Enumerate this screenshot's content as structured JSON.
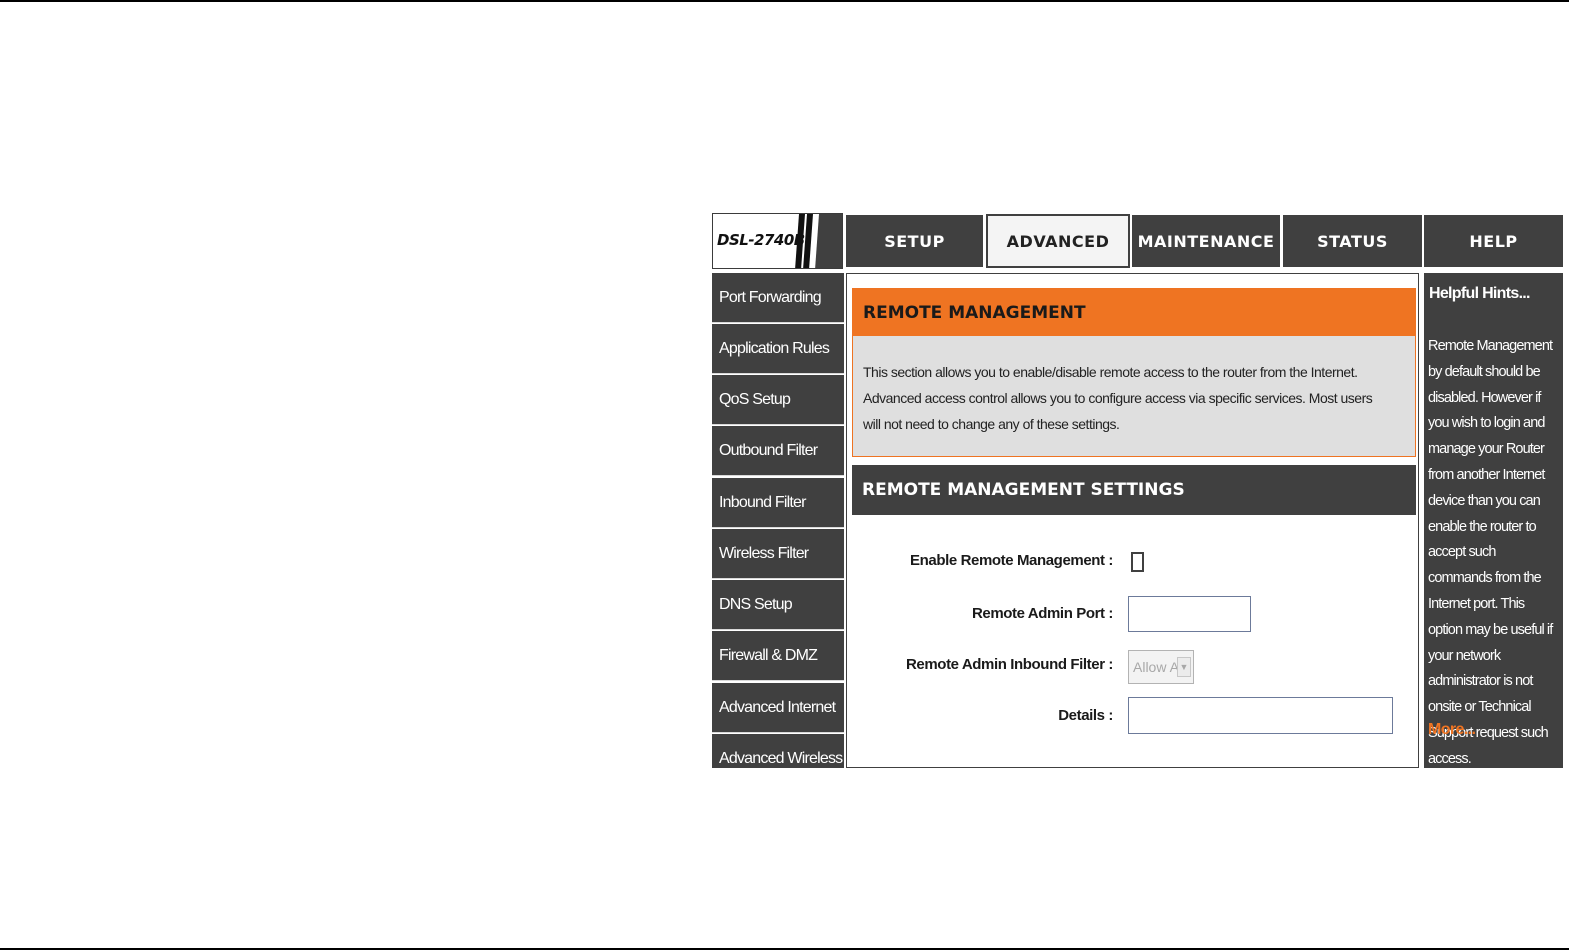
{
  "header": {
    "model": "DSL-2740B",
    "tabs": [
      {
        "label": "SETUP",
        "active": false
      },
      {
        "label": "ADVANCED",
        "active": true
      },
      {
        "label": "MAINTENANCE",
        "active": false
      },
      {
        "label": "STATUS",
        "active": false
      },
      {
        "label": "HELP",
        "active": false
      }
    ]
  },
  "sidebar": {
    "items": [
      {
        "label": "Port Forwarding"
      },
      {
        "label": "Application Rules"
      },
      {
        "label": "QoS Setup"
      },
      {
        "label": "Outbound Filter"
      },
      {
        "label": "Inbound Filter"
      },
      {
        "label": "Wireless Filter"
      },
      {
        "label": "DNS Setup"
      },
      {
        "label": "Firewall & DMZ"
      },
      {
        "label": "Advanced Internet"
      },
      {
        "label": "Advanced Wireless"
      }
    ]
  },
  "main": {
    "intro_title": "REMOTE MANAGEMENT",
    "intro_text": "This section allows you to enable/disable remote access to the router from the Internet. Advanced access control allows you to configure access via specific services. Most users will not need to change any of these settings.",
    "settings_title": "REMOTE MANAGEMENT SETTINGS",
    "fields": {
      "enable_label": "Enable Remote Management :",
      "enable_checked": false,
      "port_label": "Remote Admin Port :",
      "port_value": "",
      "filter_label": "Remote Admin Inbound Filter :",
      "filter_value": "Allow All",
      "details_label": "Details :",
      "details_value": ""
    }
  },
  "hints": {
    "title": "Helpful Hints...",
    "text": "Remote Management by default should be disabled. However if you wish to login and manage your Router from another Internet device than you can enable the router to accept such commands from the Internet port. This option may be useful if your network administrator is not onsite or Technical Support request such access.",
    "more": "More..."
  },
  "colors": {
    "dark": "#404040",
    "accent_orange": "#ef7422",
    "intro_bg": "#dfdfdf"
  }
}
